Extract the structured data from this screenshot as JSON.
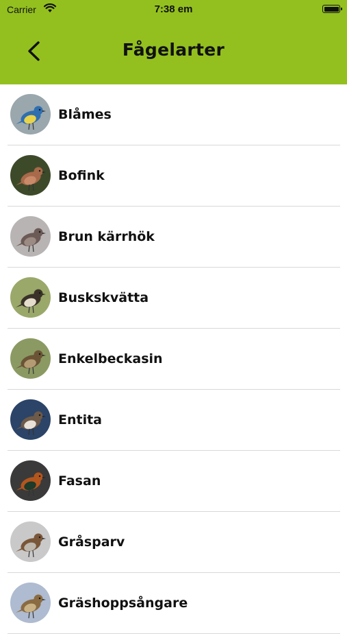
{
  "status_bar": {
    "carrier": "Carrier",
    "time": "7:38 em",
    "battery_level": 1.0
  },
  "header": {
    "title": "Fågelarter",
    "back_icon": "chevron-left-icon",
    "background_color": "#93c01f"
  },
  "birds": [
    {
      "name": "Blåmes",
      "photo": {
        "bg": "#9aa7ad",
        "body": "#2f6fb0",
        "belly": "#e9d34a"
      }
    },
    {
      "name": "Bofink",
      "photo": {
        "bg": "#3d4a2a",
        "body": "#a86a4a",
        "belly": "#c98a6a"
      }
    },
    {
      "name": "Brun kärrhök",
      "photo": {
        "bg": "#b9b4b4",
        "body": "#6b5a55",
        "belly": "#9c8a84"
      }
    },
    {
      "name": "Buskskvätta",
      "photo": {
        "bg": "#9aa86a",
        "body": "#3a3228",
        "belly": "#e6dccb"
      }
    },
    {
      "name": "Enkelbeckasin",
      "photo": {
        "bg": "#8b9a63",
        "body": "#6b5436",
        "belly": "#b59b73"
      }
    },
    {
      "name": "Entita",
      "photo": {
        "bg": "#2b4468",
        "body": "#6d5a48",
        "belly": "#e8e2d8"
      }
    },
    {
      "name": "Fasan",
      "photo": {
        "bg": "#3a3a3a",
        "body": "#b2561e",
        "belly": "#1d3a2a"
      }
    },
    {
      "name": "Gråsparv",
      "photo": {
        "bg": "#c9c9c9",
        "body": "#7a5638",
        "belly": "#bdb7ad"
      }
    },
    {
      "name": "Gräshoppsångare",
      "photo": {
        "bg": "#aebbd0",
        "body": "#8a6b42",
        "belly": "#c9b285"
      }
    }
  ]
}
